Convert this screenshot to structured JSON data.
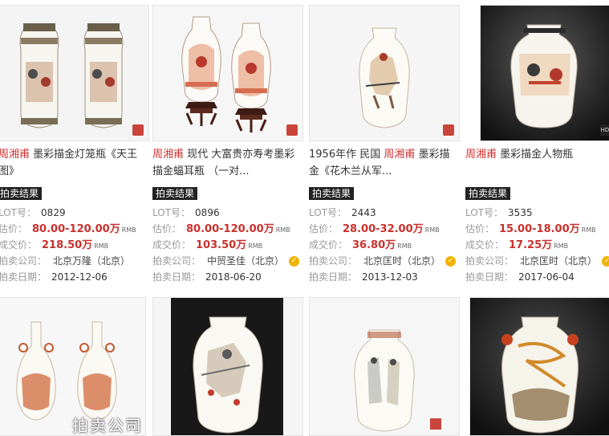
{
  "labels": {
    "result_badge": "拍卖结果",
    "lot": "LOT号：",
    "estimate": "估价：",
    "deal": "成交价：",
    "company": "拍卖公司：",
    "date": "拍卖日期：",
    "unit": "RMB",
    "verified_mark": "✓",
    "hd": "HD"
  },
  "items": [
    {
      "artist": "周湘甫",
      "title_rest": " 墨彩描金灯笼瓶《天王图》",
      "lot": "0829",
      "estimate": "80.00-120.00万",
      "deal": "218.50万",
      "company": "北京万隆（北京）",
      "verified": false,
      "date": "2012-12-06"
    },
    {
      "pre_title": "",
      "artist": "周湘甫",
      "title_rest": " 现代 大富贵亦寿考墨彩描金蝠耳瓶 （一对...",
      "lot": "0896",
      "estimate": "80.00-120.00万",
      "deal": "103.50万",
      "company": "中贸圣佳（北京）",
      "verified": true,
      "date": "2018-06-20"
    },
    {
      "pre_title": "1956年作 民国 ",
      "artist": "周湘甫",
      "title_rest": " 墨彩描金《花木兰从军...",
      "lot": "2443",
      "estimate": "28.00-32.00万",
      "deal": "36.80万",
      "company": "北京匡时（北京）",
      "verified": true,
      "date": "2013-12-03"
    },
    {
      "pre_title": "",
      "artist": "周湘甫",
      "title_rest": " 墨彩描金人物瓶",
      "lot": "3535",
      "estimate": "15.00-18.00万",
      "deal": "17.25万",
      "company": "北京匡时（北京）",
      "verified": true,
      "date": "2017-06-04"
    }
  ],
  "watermark": "拍卖公司",
  "colors": {
    "accent_red": "#d0302f",
    "badge_bg": "#222222",
    "verified_gold": "#f0b400"
  }
}
